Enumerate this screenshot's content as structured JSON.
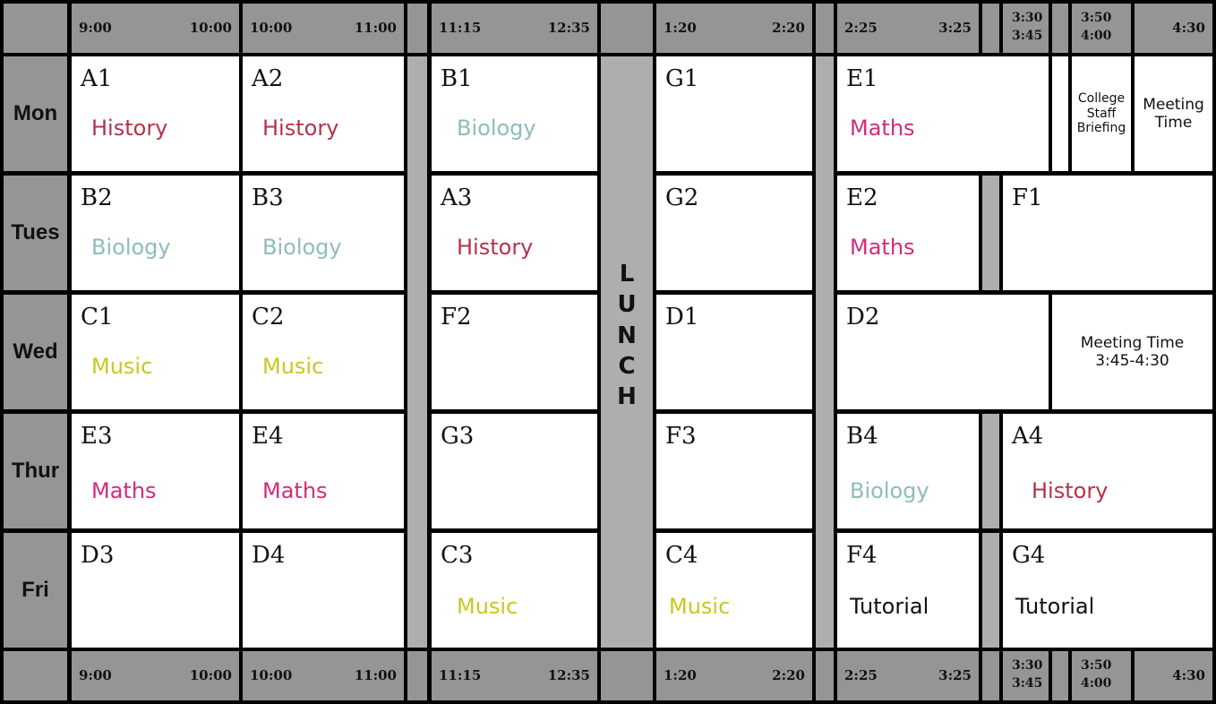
{
  "timetable": {
    "days": [
      "Mon",
      "Tues",
      "Wed",
      "Thur",
      "Fri"
    ],
    "lunch_label": "LUNCH",
    "header_top": {
      "p1_start": "9:00",
      "p1_end": "10:00",
      "p2_start": "10:00",
      "p2_end": "11:00",
      "p3_start": "11:15",
      "p3_end": "12:35",
      "p4_start": "1:20",
      "p4_end": "2:20",
      "p5_start": "2:25",
      "p5_end": "3:25",
      "s1_top": "3:30",
      "s1_bottom": "3:45",
      "s2_top": "3:50",
      "s2_bottom": "4:00",
      "end": "4:30"
    },
    "header_bottom": {
      "p1_start": "9:00",
      "p1_end": "10:00",
      "p2_start": "10:00",
      "p2_end": "11:00",
      "p3_start": "11:15",
      "p3_end": "12:35",
      "p4_start": "1:20",
      "p4_end": "2:20",
      "p5_start": "2:25",
      "p5_end": "3:25",
      "s1_top": "3:30",
      "s1_bottom": "3:45",
      "s2_top": "3:50",
      "s2_bottom": "4:00",
      "end": "4:30"
    },
    "colors": {
      "history": "#b3334a",
      "biology": "#8fbcbb",
      "music": "#c8c81e",
      "maths": "#d42a7a",
      "tutorial": "#111111"
    },
    "mon": {
      "p1": {
        "code": "A1",
        "subject": "History"
      },
      "p2": {
        "code": "A2",
        "subject": "History"
      },
      "p3": {
        "code": "B1",
        "subject": "Biology"
      },
      "p4": {
        "code": "G1",
        "subject": ""
      },
      "p5": {
        "code": "E1",
        "subject": "Maths"
      },
      "briefing": "College\nStaff\nBriefing",
      "meeting": "Meeting\nTime"
    },
    "tues": {
      "p1": {
        "code": "B2",
        "subject": "Biology"
      },
      "p2": {
        "code": "B3",
        "subject": "Biology"
      },
      "p3": {
        "code": "A3",
        "subject": "History"
      },
      "p4": {
        "code": "G2",
        "subject": ""
      },
      "p5": {
        "code": "E2",
        "subject": "Maths"
      },
      "p6": {
        "code": "F1",
        "subject": ""
      }
    },
    "wed": {
      "p1": {
        "code": "C1",
        "subject": "Music"
      },
      "p2": {
        "code": "C2",
        "subject": "Music"
      },
      "p3": {
        "code": "F2",
        "subject": ""
      },
      "p4": {
        "code": "D1",
        "subject": ""
      },
      "p5": {
        "code": "D2",
        "subject": ""
      },
      "meeting": "Meeting Time\n3:45-4:30"
    },
    "thur": {
      "p1": {
        "code": "E3",
        "subject": "Maths"
      },
      "p2": {
        "code": "E4",
        "subject": "Maths"
      },
      "p3": {
        "code": "G3",
        "subject": ""
      },
      "p4": {
        "code": "F3",
        "subject": ""
      },
      "p5": {
        "code": "B4",
        "subject": "Biology"
      },
      "p6": {
        "code": "A4",
        "subject": "History"
      }
    },
    "fri": {
      "p1": {
        "code": "D3",
        "subject": ""
      },
      "p2": {
        "code": "D4",
        "subject": ""
      },
      "p3": {
        "code": "C3",
        "subject": "Music"
      },
      "p4": {
        "code": "C4",
        "subject": "Music"
      },
      "p5": {
        "code": "F4",
        "subject": "Tutorial"
      },
      "p6": {
        "code": "G4",
        "subject": "Tutorial"
      }
    }
  }
}
